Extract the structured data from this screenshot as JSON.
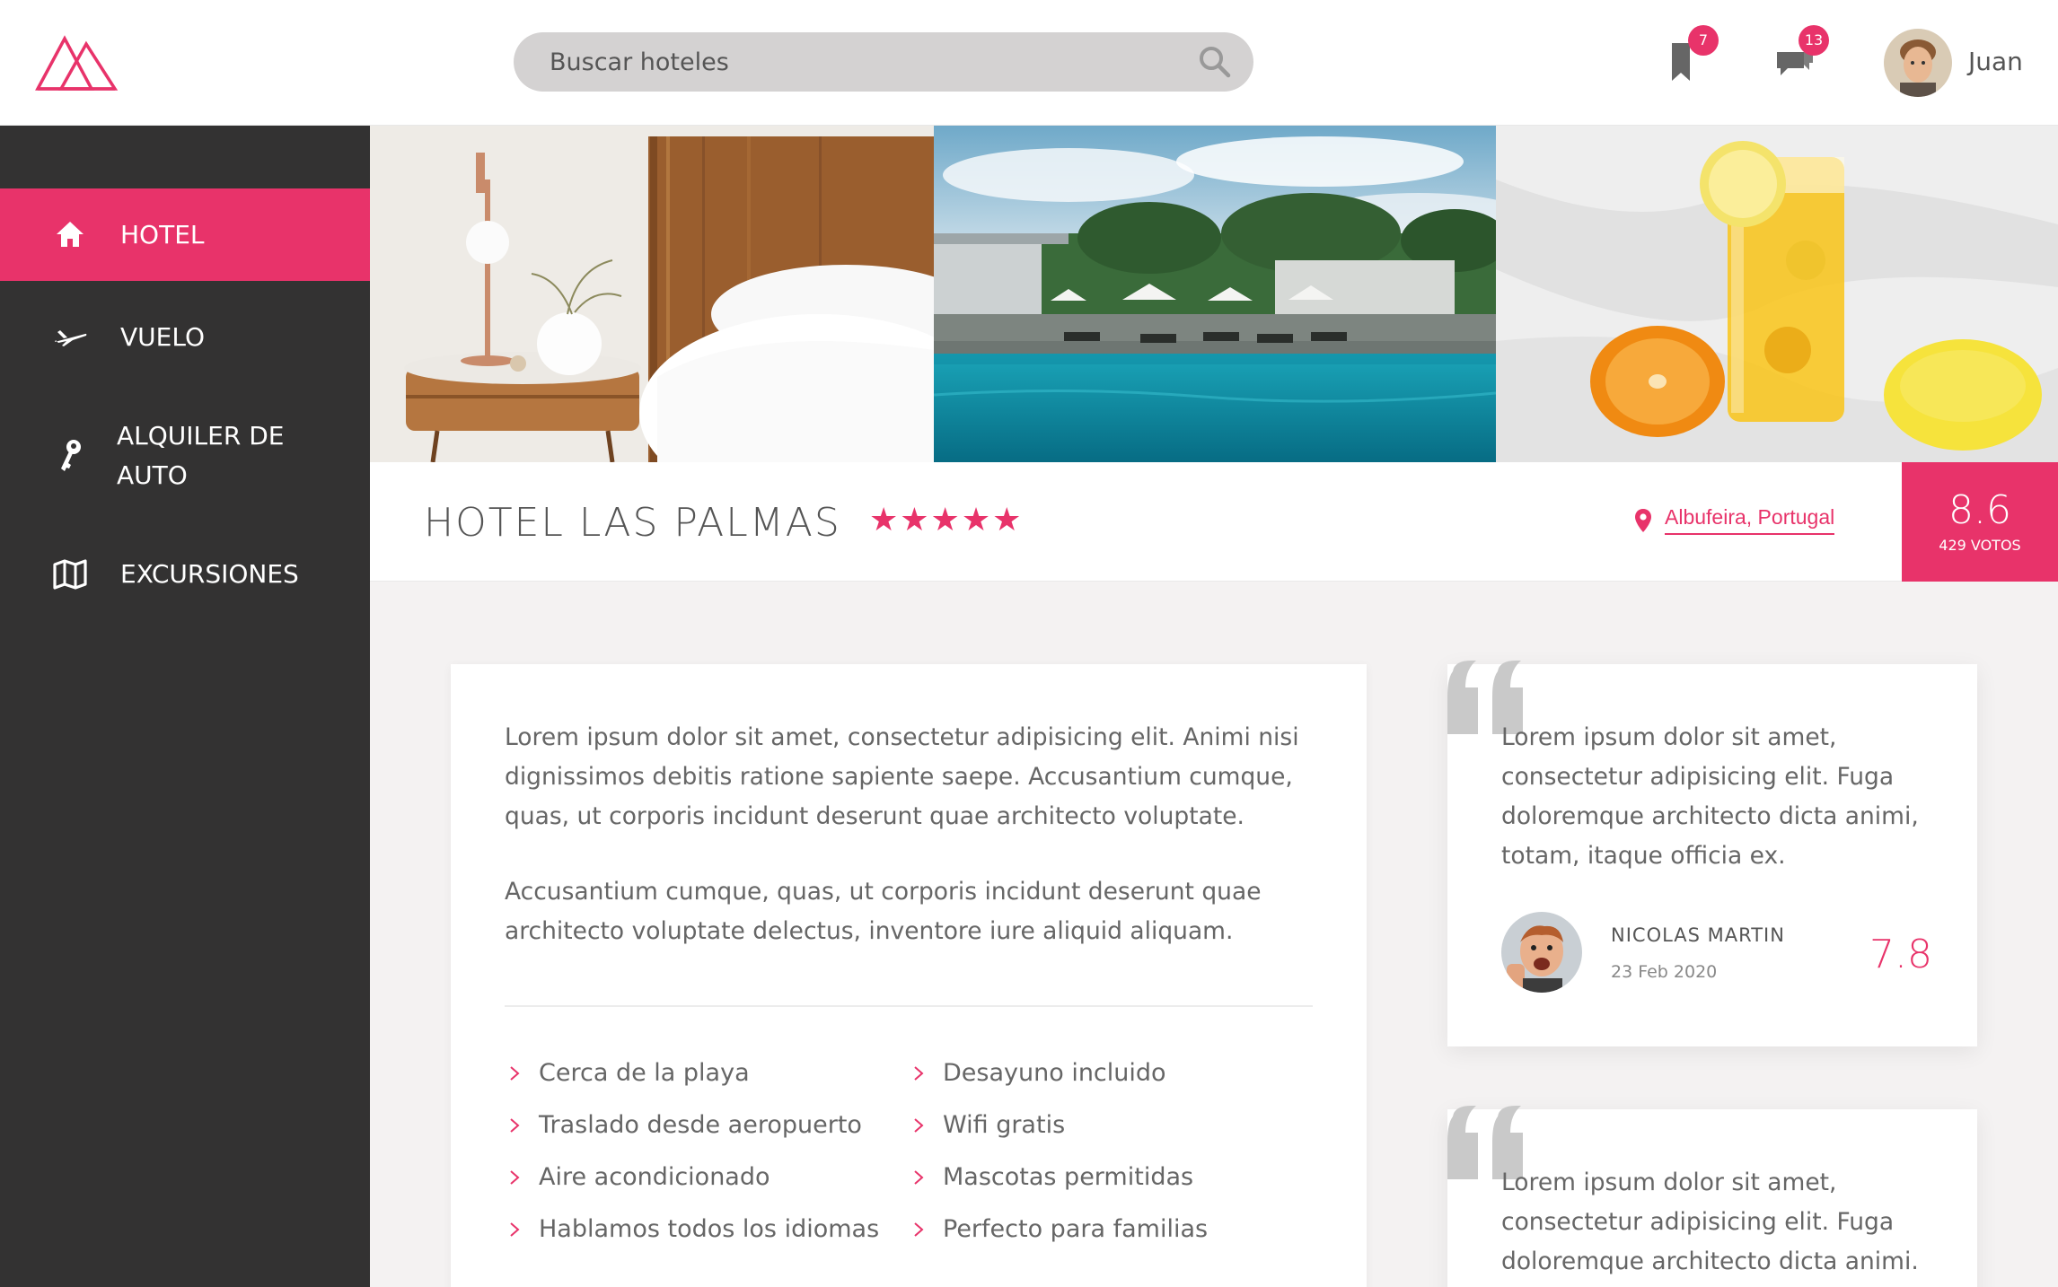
{
  "header": {
    "search_placeholder": "Buscar hoteles",
    "bookmarks_count": "7",
    "messages_count": "13",
    "user_name": "Juan"
  },
  "sidebar": {
    "items": [
      {
        "label": "HOTEL",
        "icon": "home-icon",
        "active": true
      },
      {
        "label": "VUELO",
        "icon": "plane-icon",
        "active": false
      },
      {
        "label": "ALQUILER DE AUTO",
        "icon": "key-icon",
        "active": false
      },
      {
        "label": "EXCURSIONES",
        "icon": "map-icon",
        "active": false
      }
    ]
  },
  "hotel": {
    "name": "HOTEL LAS PALMAS",
    "stars": "★★★★★",
    "location": "Albufeira, Portugal",
    "score": "8.6",
    "votes": "429 VOTOS"
  },
  "description": {
    "paragraphs": [
      "Lorem ipsum dolor sit amet, consectetur adipisicing elit. Animi nisi dignissimos debitis ratione sapiente saepe. Accusantium cumque, quas, ut corporis incidunt deserunt quae architecto voluptate.",
      "Accusantium cumque, quas, ut corporis incidunt deserunt quae architecto voluptate delectus, inventore iure aliquid aliquam."
    ],
    "amenities_left": [
      "Cerca de la playa",
      "Traslado desde aeropuerto",
      "Aire acondicionado",
      "Hablamos todos los idiomas"
    ],
    "amenities_right": [
      "Desayuno incluido",
      "Wifi gratis",
      "Mascotas permitidas",
      "Perfecto para familias"
    ]
  },
  "reviews": [
    {
      "text": "Lorem ipsum dolor sit amet, consectetur adipisicing elit. Fuga doloremque architecto dicta animi, totam, itaque officia ex.",
      "name": "NICOLAS MARTIN",
      "date": "23 Feb 2020",
      "score": "7.8"
    },
    {
      "text": "Lorem ipsum dolor sit amet, consectetur adipisicing elit. Fuga doloremque architecto dicta animi."
    }
  ],
  "colors": {
    "accent": "#e8336a",
    "sidebar": "#333232",
    "background": "#f4f2f2"
  }
}
